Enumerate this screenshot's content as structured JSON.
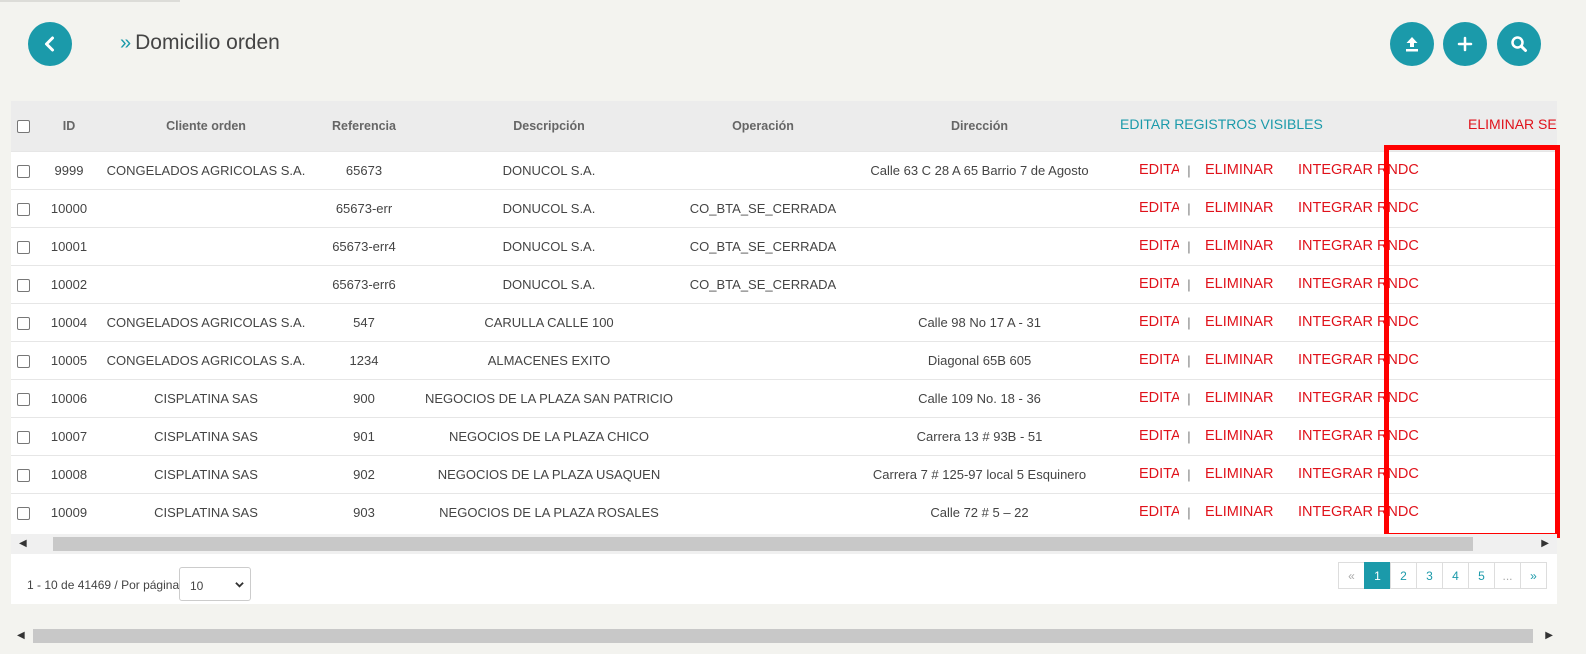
{
  "header": {
    "breadcrumb_prefix": "»",
    "title": "Domicilio orden"
  },
  "icons": {
    "back": "chevron-left-icon",
    "upload": "upload-icon",
    "add": "plus-icon",
    "search": "search-icon"
  },
  "table": {
    "columns": {
      "id": "ID",
      "client": "Cliente orden",
      "reference": "Referencia",
      "description": "Descripción",
      "operation": "Operación",
      "address": "Dirección",
      "edit_all": "EDITAR REGISTROS VISIBLES",
      "delete_selected": "ELIMINAR SELECCIONAD"
    },
    "action_labels": {
      "edit": "EDITAR",
      "separator": "|",
      "delete": "ELIMINAR",
      "integrate": "INTEGRAR RNDC"
    },
    "rows": [
      {
        "id": "9999",
        "client": "CONGELADOS AGRICOLAS S.A.",
        "reference": "65673",
        "description": "DONUCOL S.A.",
        "operation": "",
        "address": "Calle 63 C 28 A 65 Barrio 7 de Agosto"
      },
      {
        "id": "10000",
        "client": "",
        "reference": "65673-err",
        "description": "DONUCOL S.A.",
        "operation": "CO_BTA_SE_CERRADA",
        "address": ""
      },
      {
        "id": "10001",
        "client": "",
        "reference": "65673-err4",
        "description": "DONUCOL S.A.",
        "operation": "CO_BTA_SE_CERRADA",
        "address": ""
      },
      {
        "id": "10002",
        "client": "",
        "reference": "65673-err6",
        "description": "DONUCOL S.A.",
        "operation": "CO_BTA_SE_CERRADA",
        "address": ""
      },
      {
        "id": "10004",
        "client": "CONGELADOS AGRICOLAS S.A.",
        "reference": "547",
        "description": "CARULLA CALLE 100",
        "operation": "",
        "address": "Calle 98 No 17 A - 31"
      },
      {
        "id": "10005",
        "client": "CONGELADOS AGRICOLAS S.A.",
        "reference": "1234",
        "description": "ALMACENES EXITO",
        "operation": "",
        "address": "Diagonal 65B 605"
      },
      {
        "id": "10006",
        "client": "CISPLATINA SAS",
        "reference": "900",
        "description": "NEGOCIOS DE LA PLAZA SAN PATRICIO",
        "operation": "",
        "address": "Calle 109 No. 18 - 36"
      },
      {
        "id": "10007",
        "client": "CISPLATINA SAS",
        "reference": "901",
        "description": "NEGOCIOS DE LA PLAZA CHICO",
        "operation": "",
        "address": "Carrera 13 # 93B - 51"
      },
      {
        "id": "10008",
        "client": "CISPLATINA SAS",
        "reference": "902",
        "description": "NEGOCIOS DE LA PLAZA USAQUEN",
        "operation": "",
        "address": "Carrera 7 # 125-97 local 5 Esquinero"
      },
      {
        "id": "10009",
        "client": "CISPLATINA SAS",
        "reference": "903",
        "description": "NEGOCIOS DE LA PLAZA ROSALES",
        "operation": "",
        "address": "Calle 72 # 5 – 22"
      }
    ]
  },
  "footer": {
    "records": "1 - 10 de 41469 / Por página",
    "per_page": "10",
    "pages": [
      "«",
      "1",
      "2",
      "3",
      "4",
      "5",
      "...",
      "»"
    ],
    "active_page": "1"
  },
  "colors": {
    "accent": "#1b9aaa",
    "danger": "#e0121b",
    "highlight": "#ff0000"
  }
}
